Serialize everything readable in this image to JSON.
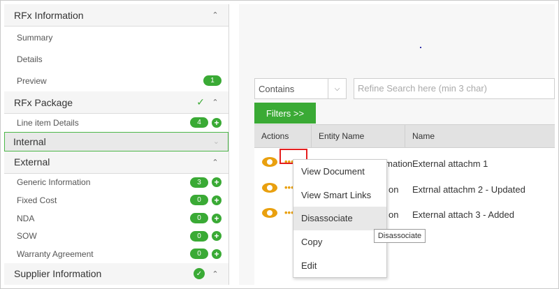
{
  "sidebar": {
    "rfx_information": {
      "title": "RFx Information",
      "items": [
        {
          "label": "Summary"
        },
        {
          "label": "Details"
        },
        {
          "label": "Preview",
          "count": "1"
        }
      ]
    },
    "rfx_package": {
      "title": "RFx Package",
      "items": [
        {
          "label": "Line item Details",
          "count": "4"
        }
      ]
    },
    "internal": {
      "title": "Internal"
    },
    "external": {
      "title": "External",
      "items": [
        {
          "label": "Generic Information",
          "count": "3"
        },
        {
          "label": "Fixed Cost",
          "count": "0"
        },
        {
          "label": "NDA",
          "count": "0"
        },
        {
          "label": "SOW",
          "count": "0"
        },
        {
          "label": "Warranty Agreement",
          "count": "0"
        }
      ]
    },
    "supplier_information": {
      "title": "Supplier Information"
    }
  },
  "filter": {
    "operator": "Contains",
    "search_placeholder": "Refine Search here (min 3 char)",
    "filters_label": "Filters >>"
  },
  "table": {
    "columns": [
      "Actions",
      "Entity Name",
      "Name"
    ],
    "rows": [
      {
        "entity": "Generic Information",
        "name": "External attachm 1"
      },
      {
        "entity": "on",
        "name": "Extrnal attachm 2 - Updated"
      },
      {
        "entity": "on",
        "name": "External attach 3 - Added"
      }
    ]
  },
  "context_menu": {
    "items": [
      "View Document",
      "View Smart Links",
      "Disassociate",
      "Copy",
      "Edit"
    ],
    "tooltip": "Disassociate"
  },
  "colors": {
    "accent_green": "#3aaa35",
    "action_orange": "#e9a00f",
    "highlight_red": "#e41e1e"
  }
}
